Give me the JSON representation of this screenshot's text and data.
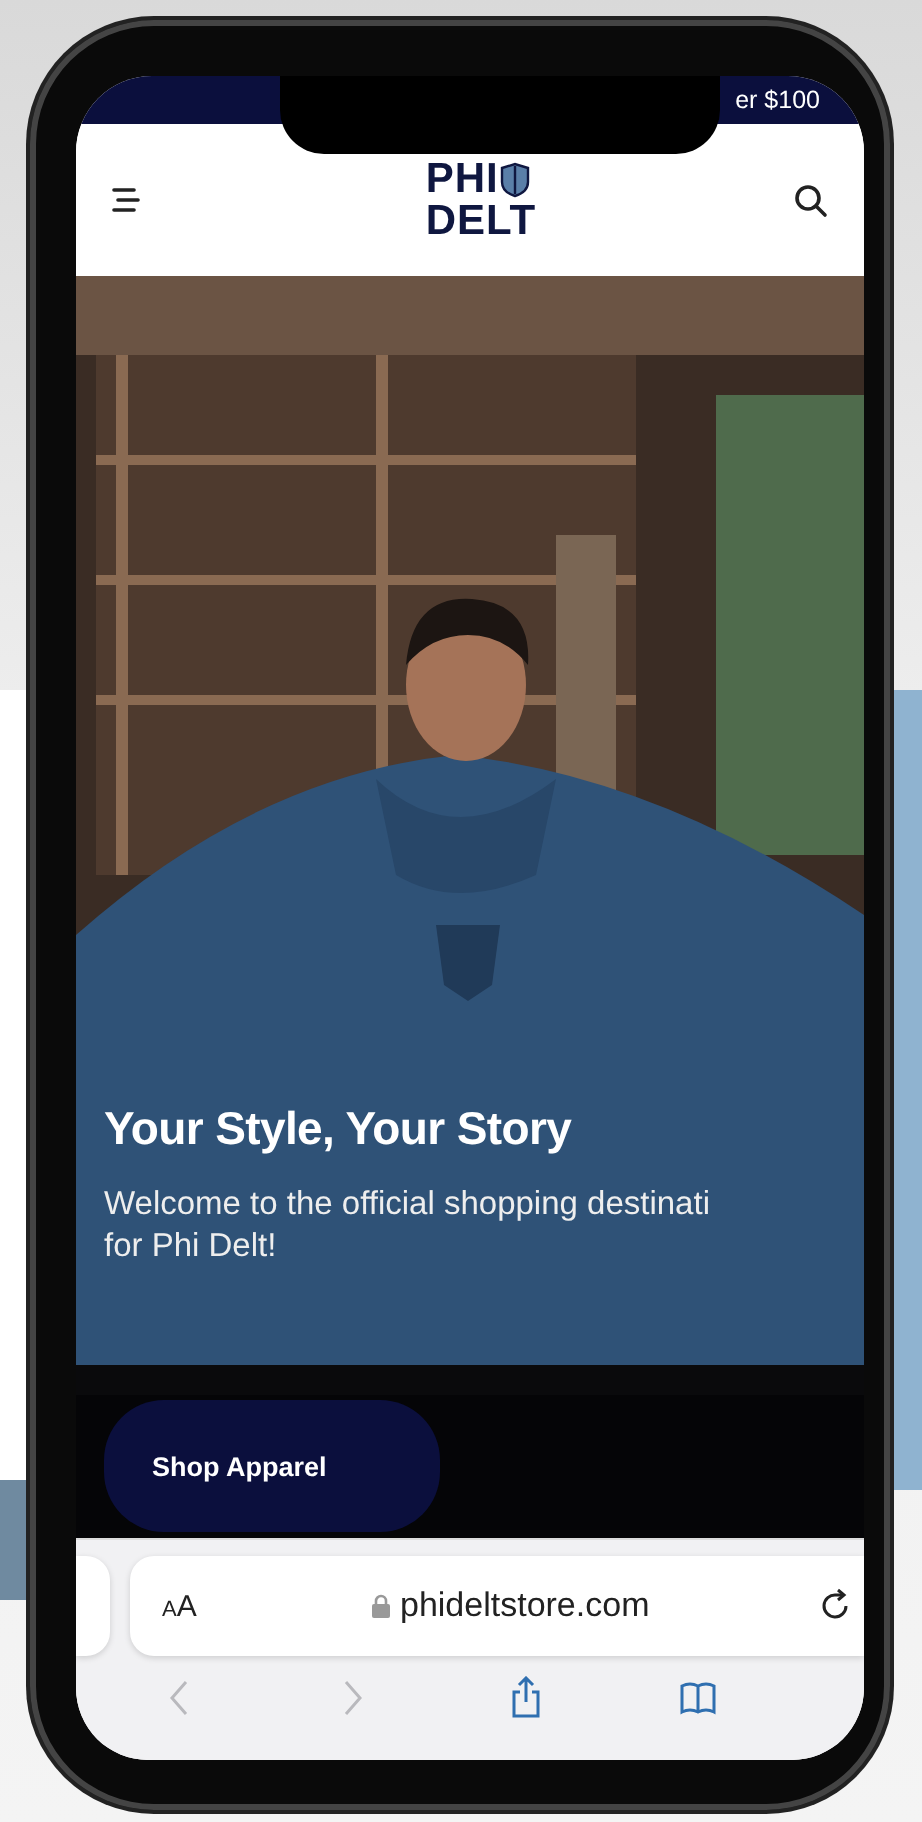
{
  "announcement": {
    "text": "er $100"
  },
  "header": {
    "logo": {
      "line_1": "PHI",
      "line_2": "DELT"
    }
  },
  "hero": {
    "kind": "picture",
    "title": "Your Style, Your Story",
    "text_lines": [
      "Welcome to the official shopping destinati",
      "for Phi Delt!"
    ],
    "button": "Shop Apparel"
  },
  "browser": {
    "text_size": "AA",
    "url": "phideltstore.com",
    "toolbar": [
      {
        "kind": "back",
        "disabled": true
      },
      {
        "kind": "forward",
        "disabled": true
      },
      {
        "kind": "share",
        "disabled": false
      },
      {
        "kind": "bookmarks",
        "disabled": false
      }
    ]
  }
}
